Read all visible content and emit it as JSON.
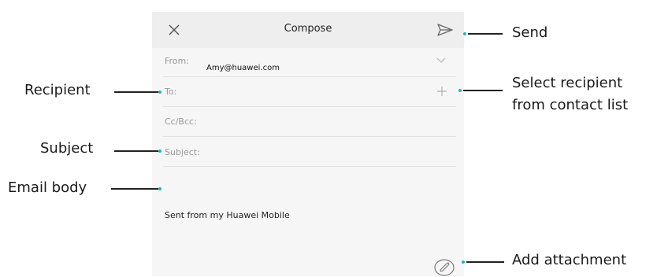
{
  "compose": {
    "title": "Compose",
    "from_label": "From:",
    "from_value": "Amy@huawei.com",
    "to_label": "To:",
    "cc_label": "Cc/Bcc:",
    "subject_label": "Subject:",
    "signature": "Sent from my Huawei Mobile"
  },
  "callouts": {
    "send": "Send",
    "select_recipient_line1": "Select recipient",
    "select_recipient_line2": "from contact list",
    "recipient": "Recipient",
    "subject": "Subject",
    "email_body": "Email body",
    "add_attachment": "Add attachment"
  },
  "icons": {
    "close": "close-icon",
    "send": "send-icon",
    "expand": "chevron-down-icon",
    "add_contact": "plus-icon",
    "attachment": "paperclip-icon"
  },
  "colors": {
    "accent": "#2bb3ad",
    "topbar": "#eeeeee",
    "screen": "#f6f6f6"
  }
}
